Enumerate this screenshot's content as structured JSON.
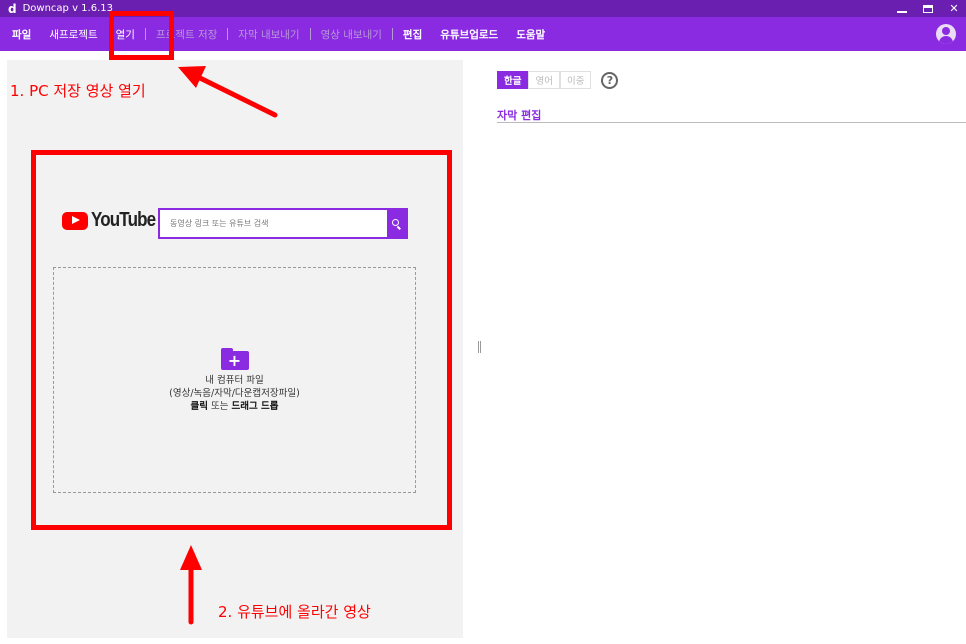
{
  "window": {
    "logo": "d",
    "title": "Downcap v 1.6.13",
    "close_glyph": "✕"
  },
  "menu": {
    "items": [
      {
        "label": "파일",
        "state": "bold"
      },
      {
        "label": "새프로젝트",
        "state": "normal"
      },
      {
        "label": "열기",
        "state": "normal"
      },
      {
        "label": "프로젝트 저장",
        "state": "dim"
      },
      {
        "label": "자막 내보내기",
        "state": "dim"
      },
      {
        "label": "영상 내보내기",
        "state": "dim"
      },
      {
        "label": "편집",
        "state": "bold"
      },
      {
        "label": "유튜브업로드",
        "state": "bold"
      },
      {
        "label": "도움말",
        "state": "bold"
      }
    ]
  },
  "youtube": {
    "logo_text": "YouTube",
    "search_placeholder": "동영상 링크 또는 유튜브 검색"
  },
  "drop_zone": {
    "line1": "내 컴퓨터 파일",
    "line2": "(영상/녹음/자막/다운캡저장파일)",
    "line3_bold1": "클릭",
    "line3_mid": " 또는 ",
    "line3_bold2": "드래그 드롭"
  },
  "annotations": {
    "label1": "1. PC 저장 영상 열기",
    "label2": "2. 유튜브에 올라간 영상",
    "color": "#ff0000"
  },
  "right_panel": {
    "lang_tabs": [
      {
        "label": "한글",
        "active": true
      },
      {
        "label": "영어",
        "active": false
      },
      {
        "label": "이중",
        "active": false
      }
    ],
    "help_glyph": "?",
    "section_title": "자막 편집"
  },
  "colors": {
    "brand": "#8a2be2",
    "titlebar": "#6a1fb0"
  }
}
